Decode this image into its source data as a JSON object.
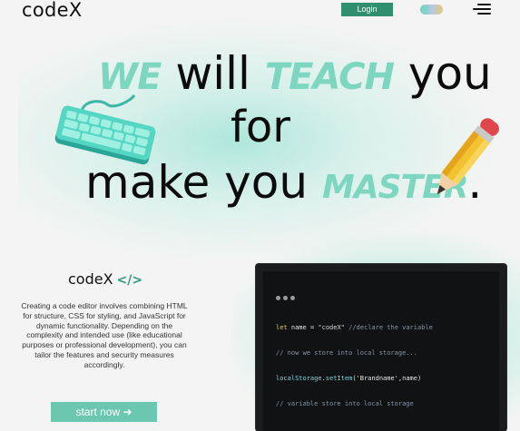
{
  "header": {
    "logo": "codeX",
    "login_label": "Login"
  },
  "hero": {
    "line1_accent": "WE",
    "line1_text": " will ",
    "line1_accent2": "TEACH",
    "line1_text2": " you",
    "line2_text": "for",
    "line3_text": "make you ",
    "line3_accent": "MASTER",
    "line3_end": "."
  },
  "info": {
    "brand": "codeX",
    "brand_icon": "</>",
    "description": "Creating a code editor involves combining HTML for structure, CSS for styling, and JavaScript for dynamic functionality. Depending on the complexity and intended use (like educational purposes or professional development), you can tailor the features and security measures accordingly.",
    "start_label": "start now ➜"
  },
  "code": {
    "line1": {
      "kw": "let",
      "name": " name ",
      "op": "= ",
      "str": "\"codeX\"",
      "comment": " //declare the variable"
    },
    "line2": "// now we store into local storage...",
    "line3": {
      "obj": "localStorage",
      "dot": ".",
      "fn": "setItem",
      "args": "('Brandname',name)"
    },
    "line4": "// variable store into local storage"
  },
  "colors": {
    "accent": "#7dd6bf",
    "login_bg": "#2f8f6e",
    "start_bg": "#6cc7b0",
    "code_bg": "#111213"
  },
  "icons": [
    "menu-icon",
    "theme-toggle",
    "code-tag-icon",
    "keyboard-illustration",
    "pencil-illustration",
    "arrow-right-icon"
  ]
}
